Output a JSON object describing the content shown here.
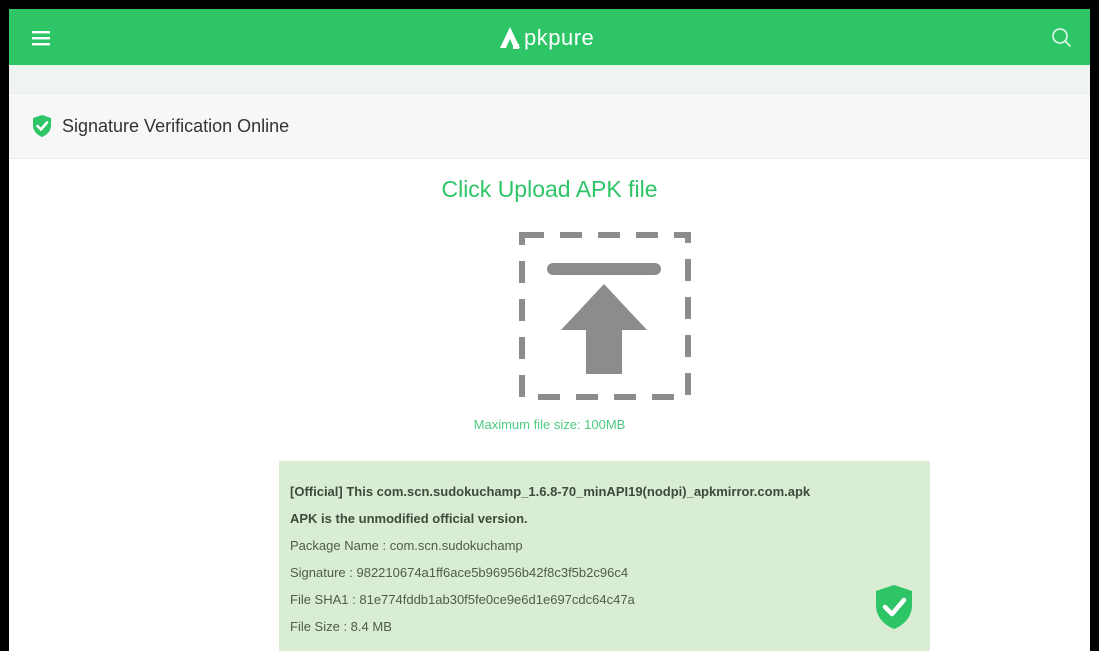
{
  "topbar": {
    "logo_text": "pkpure",
    "menu_icon": "hamburger-menu-icon",
    "search_icon": "search-icon"
  },
  "section": {
    "title": "Signature Verification Online",
    "icon": "shield-check-icon"
  },
  "upload": {
    "title": "Click Upload APK file",
    "max_size": "Maximum file size: 100MB",
    "icon": "upload-arrow-icon"
  },
  "result": {
    "headline_1": "[Official] This com.scn.sudokuchamp_1.6.8-70_minAPI19(nodpi)_apkmirror.com.apk",
    "headline_2": "APK is the unmodified official version.",
    "package_name": "Package Name : com.scn.sudokuchamp",
    "signature": "Signature : 982210674a1ff6ace5b96956b42f8c3f5b2c96c4",
    "file_sha1": "File SHA1 : 81e774fddb1ab30f5fe0ce9e6d1e697cdc64c47a",
    "file_size": "File Size : 8.4 MB",
    "icon": "verified-shield-icon"
  },
  "colors": {
    "brand": "#2ec567",
    "result_bg": "#d8edd4",
    "upload_icon": "#8c8c8c"
  }
}
